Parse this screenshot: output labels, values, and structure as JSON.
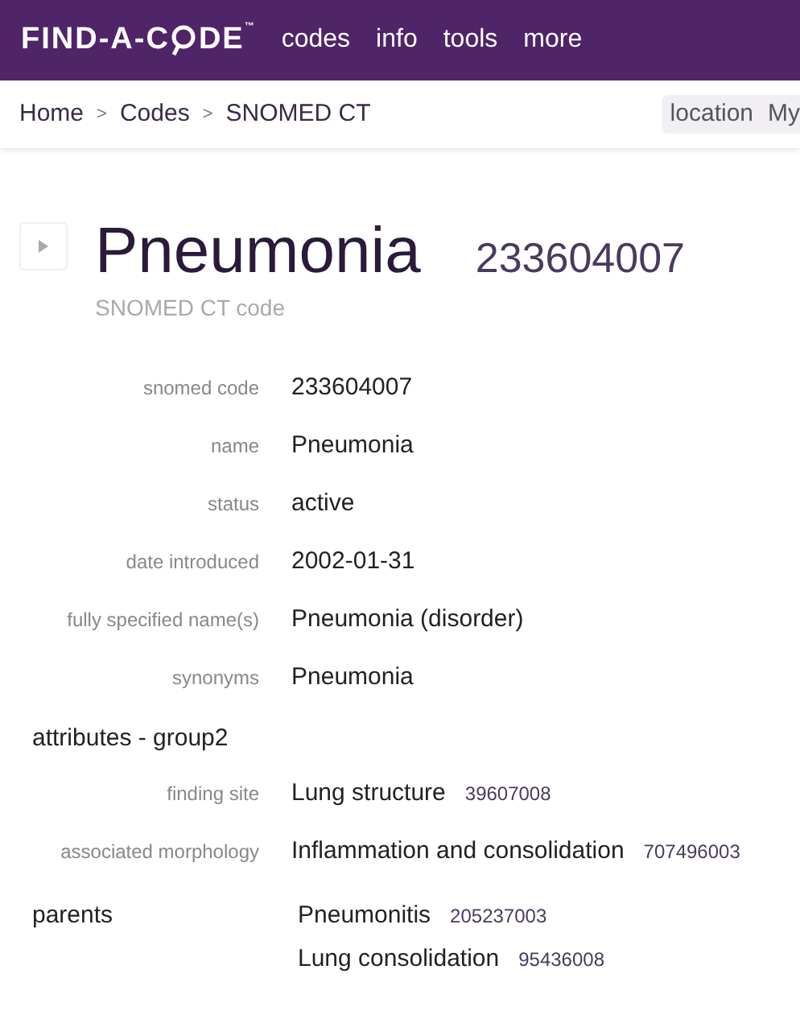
{
  "header": {
    "logo": {
      "before": "FIND-A-C",
      "after": "DE",
      "mark": "™"
    },
    "nav": [
      "codes",
      "info",
      "tools",
      "more"
    ]
  },
  "breadcrumb": {
    "items": [
      "Home",
      "Codes",
      "SNOMED CT"
    ],
    "separator": ">",
    "right": [
      "location",
      "My"
    ]
  },
  "title": {
    "name": "Pneumonia",
    "code": "233604007",
    "subtitle": "SNOMED CT code",
    "expanded": false
  },
  "fields": [
    {
      "label": "snomed code",
      "value": "233604007"
    },
    {
      "label": "name",
      "value": "Pneumonia"
    },
    {
      "label": "status",
      "value": "active"
    },
    {
      "label": "date introduced",
      "value": "2002-01-31"
    },
    {
      "label": "fully specified name(s)",
      "value": "Pneumonia (disorder)"
    },
    {
      "label": "synonyms",
      "value": "Pneumonia"
    }
  ],
  "attributes": {
    "heading": "attributes - group2",
    "rows": [
      {
        "label": "finding site",
        "value": "Lung structure",
        "code": "39607008"
      },
      {
        "label": "associated morphology",
        "value": "Inflammation and consolidation",
        "code": "707496003"
      }
    ]
  },
  "parents": {
    "heading": "parents",
    "items": [
      {
        "name": "Pneumonitis",
        "code": "205237003"
      },
      {
        "name": "Lung consolidation",
        "code": "95436008"
      }
    ]
  }
}
